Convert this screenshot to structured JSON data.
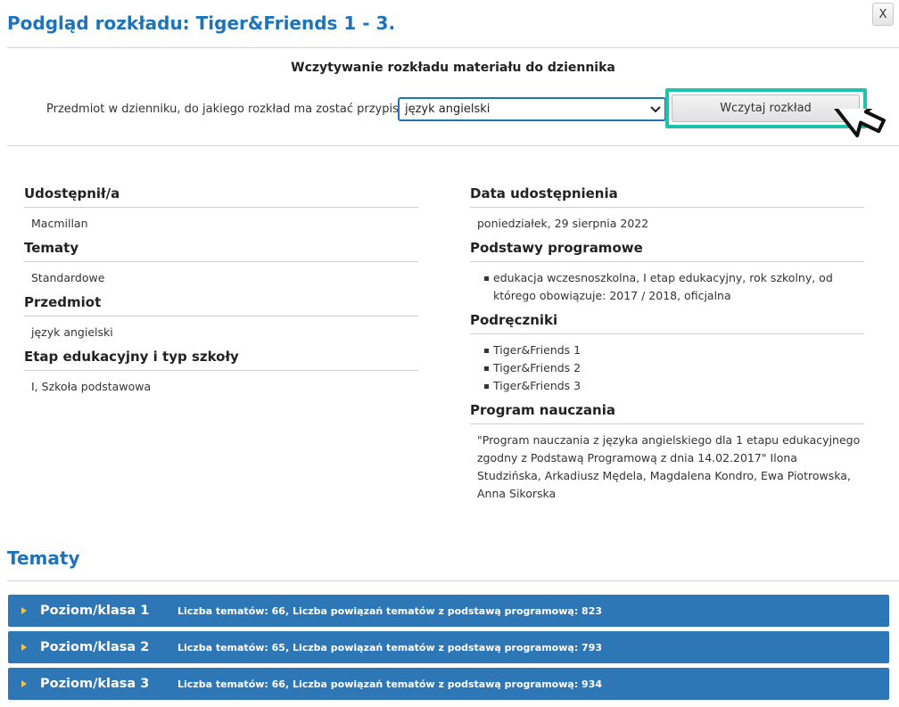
{
  "header": {
    "title": "Podgląd rozkładu: Tiger&Friends 1 - 3.",
    "close_label": "X"
  },
  "load": {
    "heading": "Wczytywanie rozkładu materiału do dziennika",
    "subject_label": "Przedmiot w dzienniku, do jakiego rozkład ma zostać przypisany:",
    "subject_selected": "język angielski",
    "load_button": "Wczytaj rozkład"
  },
  "details": {
    "shared_by": {
      "label": "Udostępnił/a",
      "value": "Macmillan"
    },
    "topics": {
      "label": "Tematy",
      "value": "Standardowe"
    },
    "subject": {
      "label": "Przedmiot",
      "value": "język angielski"
    },
    "stage": {
      "label": "Etap edukacyjny i typ szkoły",
      "value": "I, Szkoła podstawowa"
    },
    "share_date": {
      "label": "Data udostępnienia",
      "value": "poniedziałek, 29 sierpnia 2022"
    },
    "curriculum_bases": {
      "label": "Podstawy programowe",
      "items": [
        "edukacja wczesnoszkolna, I etap edukacyjny, rok szkolny, od którego obowiązuje: 2017 / 2018, oficjalna"
      ]
    },
    "textbooks": {
      "label": "Podręczniki",
      "items": [
        "Tiger&Friends 1",
        "Tiger&Friends 2",
        "Tiger&Friends 3"
      ]
    },
    "program": {
      "label": "Program nauczania",
      "value": "\"Program nauczania z języka angielskiego dla 1 etapu edukacyjnego zgodny z Podstawą Programową z dnia 14.02.2017\" Ilona Studzińska, Arkadiusz Mędela, Magdalena Kondro, Ewa Piotrowska, Anna Sikorska"
    }
  },
  "topics_section": {
    "title": "Tematy",
    "levels": [
      {
        "name": "Poziom/klasa 1",
        "info": "Liczba tematów: 66, Liczba powiązań tematów z podstawą programową: 823"
      },
      {
        "name": "Poziom/klasa 2",
        "info": "Liczba tematów: 65, Liczba powiązań tematów z podstawą programową: 793"
      },
      {
        "name": "Poziom/klasa 3",
        "info": "Liczba tematów: 66, Liczba powiązań tematów z podstawą programową: 934"
      }
    ]
  },
  "icons": {
    "close": "close-icon",
    "dropdown": "chevron-down-icon",
    "cursor": "mouse-pointer-icon",
    "expand": "caret-right-icon"
  },
  "colors": {
    "accent": "#1f73b8",
    "highlight": "#1ec3ad",
    "level_bar": "#2e77b6",
    "caret": "#f2c14e"
  }
}
